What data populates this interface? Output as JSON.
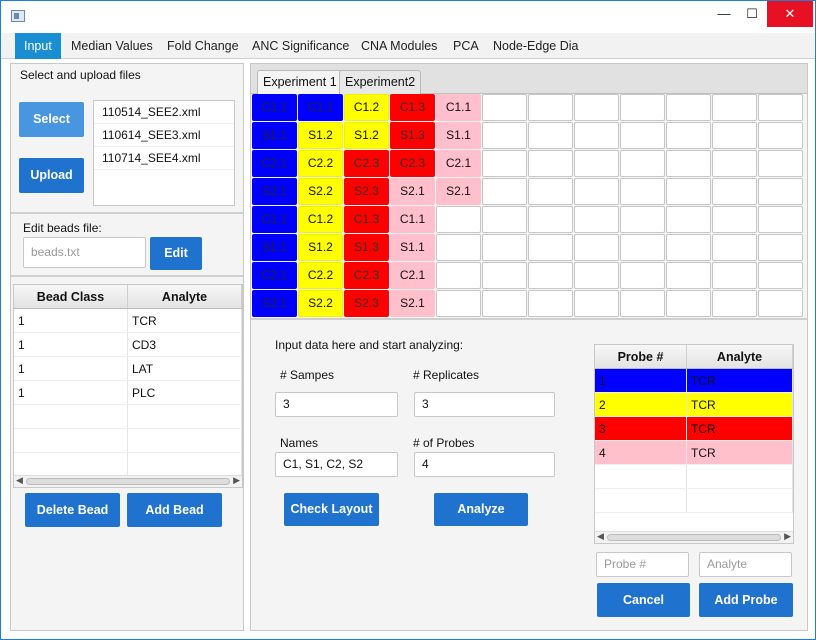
{
  "window": {
    "minimize": "—",
    "maximize": "☐",
    "close": "✕"
  },
  "menu": [
    "Input",
    "Median Values",
    "Fold Change",
    "ANC Significance",
    "CNA Modules",
    "PCA",
    "Node-Edge Dia"
  ],
  "left": {
    "upload_title": "Select and upload files",
    "select_label": "Select",
    "upload_label": "Upload",
    "files": [
      "110514_SEE2.xml",
      "110614_SEE3.xml",
      "110714_SEE4.xml"
    ],
    "beads_title": "Edit beads file:",
    "beads_placeholder": "beads.txt",
    "edit_label": "Edit",
    "bead_table": {
      "headers": [
        "Bead Class",
        "Analyte"
      ],
      "rows": [
        [
          "1",
          "TCR"
        ],
        [
          "1",
          "CD3"
        ],
        [
          "1",
          "LAT"
        ],
        [
          "1",
          "PLC"
        ]
      ]
    },
    "delete_bead_label": "Delete Bead",
    "add_bead_label": "Add Bead"
  },
  "tabs": [
    "Experiment 1",
    "Experiment2"
  ],
  "plate": {
    "rows": [
      [
        [
          "C1.1",
          "blue"
        ],
        [
          "C1.1",
          "blue"
        ],
        [
          "C1.2",
          "yellow"
        ],
        [
          "C1.3",
          "red"
        ],
        [
          "C1.1",
          "pink"
        ],
        [
          "",
          ""
        ],
        [
          "",
          ""
        ],
        [
          "",
          ""
        ],
        [
          "",
          ""
        ],
        [
          "",
          ""
        ],
        [
          "",
          ""
        ],
        [
          "",
          ""
        ]
      ],
      [
        [
          "S1.1",
          "blue"
        ],
        [
          "S1.2",
          "yellow"
        ],
        [
          "S1.2",
          "yellow"
        ],
        [
          "S1.3",
          "red"
        ],
        [
          "S1.1",
          "pink"
        ],
        [
          "",
          ""
        ],
        [
          "",
          ""
        ],
        [
          "",
          ""
        ],
        [
          "",
          ""
        ],
        [
          "",
          ""
        ],
        [
          "",
          ""
        ],
        [
          "",
          ""
        ]
      ],
      [
        [
          "C2.1",
          "blue"
        ],
        [
          "C2.2",
          "yellow"
        ],
        [
          "C2.3",
          "red"
        ],
        [
          "C2.3",
          "red"
        ],
        [
          "C2.1",
          "pink"
        ],
        [
          "",
          ""
        ],
        [
          "",
          ""
        ],
        [
          "",
          ""
        ],
        [
          "",
          ""
        ],
        [
          "",
          ""
        ],
        [
          "",
          ""
        ],
        [
          "",
          ""
        ]
      ],
      [
        [
          "S2.1",
          "blue"
        ],
        [
          "S2.2",
          "yellow"
        ],
        [
          "S2.3",
          "red"
        ],
        [
          "S2.1",
          "pink"
        ],
        [
          "S2.1",
          "pink"
        ],
        [
          "",
          ""
        ],
        [
          "",
          ""
        ],
        [
          "",
          ""
        ],
        [
          "",
          ""
        ],
        [
          "",
          ""
        ],
        [
          "",
          ""
        ],
        [
          "",
          ""
        ]
      ],
      [
        [
          "C1.1",
          "blue"
        ],
        [
          "C1.2",
          "yellow"
        ],
        [
          "C1.3",
          "red"
        ],
        [
          "C1.1",
          "pink"
        ],
        [
          "",
          ""
        ],
        [
          "",
          ""
        ],
        [
          "",
          ""
        ],
        [
          "",
          ""
        ],
        [
          "",
          ""
        ],
        [
          "",
          ""
        ],
        [
          "",
          ""
        ],
        [
          "",
          ""
        ]
      ],
      [
        [
          "S1.1",
          "blue"
        ],
        [
          "S1.2",
          "yellow"
        ],
        [
          "S1.3",
          "red"
        ],
        [
          "S1.1",
          "pink"
        ],
        [
          "",
          ""
        ],
        [
          "",
          ""
        ],
        [
          "",
          ""
        ],
        [
          "",
          ""
        ],
        [
          "",
          ""
        ],
        [
          "",
          ""
        ],
        [
          "",
          ""
        ],
        [
          "",
          ""
        ]
      ],
      [
        [
          "C2.1",
          "blue"
        ],
        [
          "C2.2",
          "yellow"
        ],
        [
          "C2.3",
          "red"
        ],
        [
          "C2.1",
          "pink"
        ],
        [
          "",
          ""
        ],
        [
          "",
          ""
        ],
        [
          "",
          ""
        ],
        [
          "",
          ""
        ],
        [
          "",
          ""
        ],
        [
          "",
          ""
        ],
        [
          "",
          ""
        ],
        [
          "",
          ""
        ]
      ],
      [
        [
          "S2.1",
          "blue"
        ],
        [
          "S2.2",
          "yellow"
        ],
        [
          "S2.3",
          "red"
        ],
        [
          "S2.1",
          "pink"
        ],
        [
          "",
          ""
        ],
        [
          "",
          ""
        ],
        [
          "",
          ""
        ],
        [
          "",
          ""
        ],
        [
          "",
          ""
        ],
        [
          "",
          ""
        ],
        [
          "",
          ""
        ],
        [
          "",
          ""
        ]
      ]
    ]
  },
  "form": {
    "intro": "Input data here and start analyzing:",
    "samples_label": "# Sampes",
    "samples_value": "3",
    "replicates_label": "# Replicates",
    "replicates_value": "3",
    "names_label": "Names",
    "names_value": "C1, S1, C2, S2",
    "probes_label": "# of Probes",
    "probes_value": "4",
    "check_layout_label": "Check Layout",
    "analyze_label": "Analyze"
  },
  "probe_table": {
    "headers": [
      "Probe #",
      "Analyte"
    ],
    "rows": [
      {
        "probe": "1",
        "analyte": "TCR",
        "color": "#0000ff"
      },
      {
        "probe": "2",
        "analyte": "TCR",
        "color": "#ffff00"
      },
      {
        "probe": "3",
        "analyte": "TCR",
        "color": "#ff0000"
      },
      {
        "probe": "4",
        "analyte": "TCR",
        "color": "#ffc0cb"
      }
    ]
  },
  "probe_inputs": {
    "probe_placeholder": "Probe #",
    "analyte_placeholder": "Analyte"
  },
  "cancel_label": "Cancel",
  "add_probe_label": "Add Probe"
}
